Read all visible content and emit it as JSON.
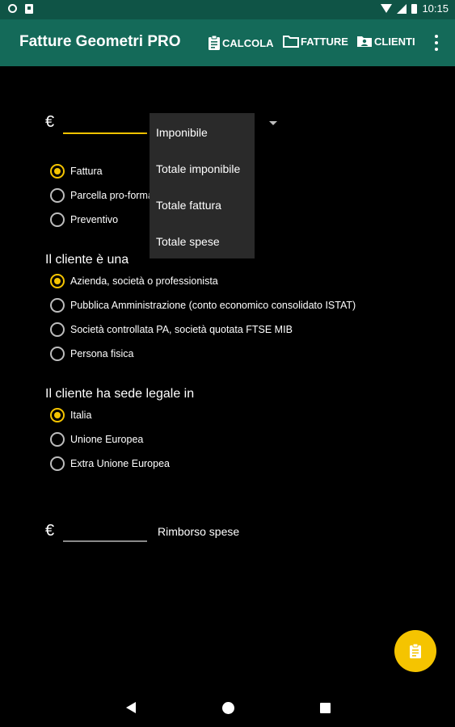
{
  "status_bar": {
    "time": "10:15"
  },
  "app_bar": {
    "title": "Fatture Geometri PRO",
    "actions": [
      {
        "label": "CALCOLA",
        "icon": "clipboard-icon"
      },
      {
        "label": "FATTURE",
        "icon": "folder-icon"
      },
      {
        "label": "CLIENTI",
        "icon": "contact-card-icon"
      }
    ]
  },
  "amount": {
    "currency": "€",
    "value": ""
  },
  "dropdown": {
    "options": [
      "Imponibile",
      "Totale imponibile",
      "Totale fattura",
      "Totale spese"
    ]
  },
  "document_type": {
    "options": [
      {
        "label": "Fattura",
        "checked": true
      },
      {
        "label": "Parcella pro-forma",
        "checked": false
      },
      {
        "label": "Preventivo",
        "checked": false
      }
    ]
  },
  "client_type": {
    "title": "Il cliente è una",
    "options": [
      {
        "label": "Azienda, società o professionista",
        "checked": true
      },
      {
        "label": "Pubblica Amministrazione (conto economico consolidato ISTAT)",
        "checked": false
      },
      {
        "label": "Società controllata PA, società quotata FTSE MIB",
        "checked": false
      },
      {
        "label": "Persona fisica",
        "checked": false
      }
    ]
  },
  "client_location": {
    "title": "Il cliente ha sede legale in",
    "options": [
      {
        "label": "Italia",
        "checked": true
      },
      {
        "label": "Unione Europea",
        "checked": false
      },
      {
        "label": "Extra Unione Europea",
        "checked": false
      }
    ]
  },
  "reimbursement": {
    "currency": "€",
    "label": "Rimborso spese",
    "value": ""
  },
  "colors": {
    "accent": "#f5c400",
    "app_bar": "#146a59",
    "status_bar": "#0f5446"
  }
}
